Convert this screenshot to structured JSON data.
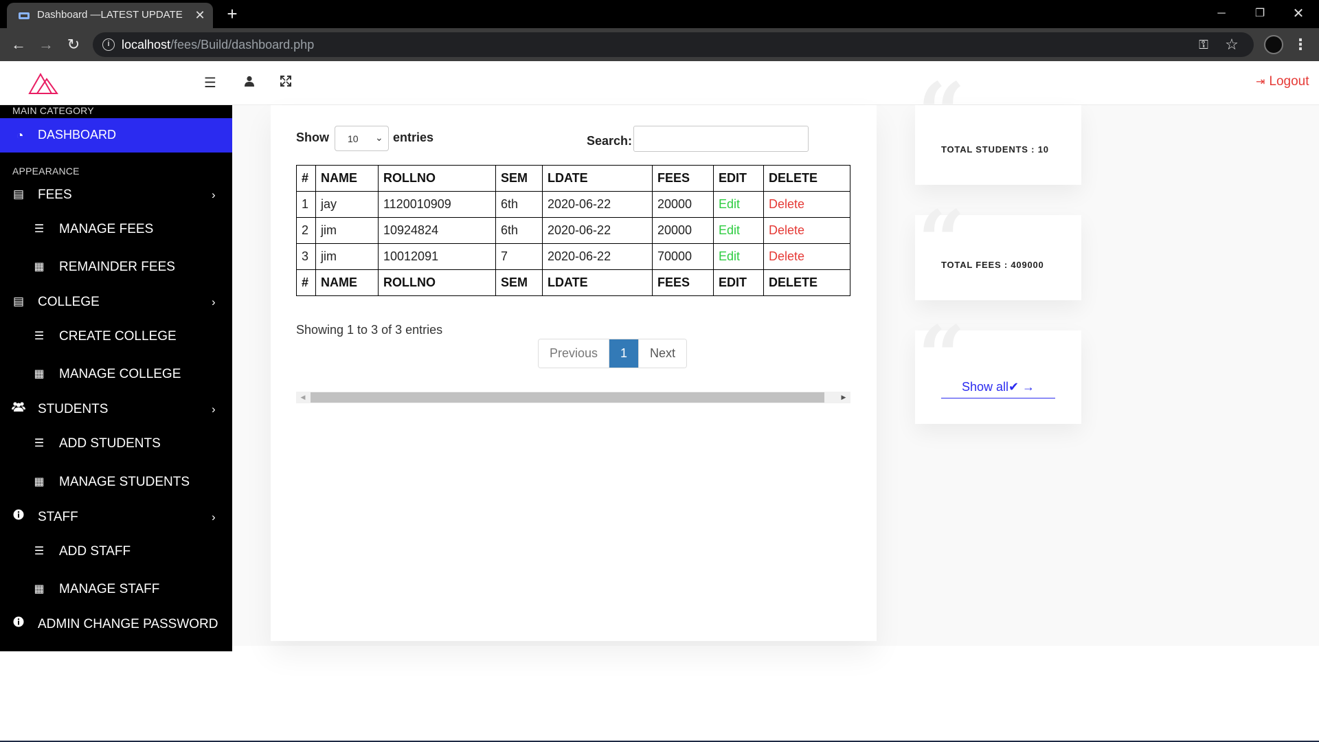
{
  "browser": {
    "tab_title": "Dashboard —LATEST UPDATE",
    "tab_close": "✕",
    "new_tab": "+",
    "url_host": "localhost",
    "url_path": "/fees/Build/dashboard.php",
    "window_controls": {
      "minimize": "─",
      "restore": "❐",
      "close": "✕"
    }
  },
  "header": {
    "logout_label": "Logout",
    "brand_color": "#e91e63"
  },
  "sidebar": {
    "main_category": "MAIN CATEGORY",
    "dashboard_label": "DASHBOARD",
    "appearance_category": "APPEARANCE",
    "sections": [
      {
        "label": "FEES",
        "icon": "file-icon",
        "children": [
          "MANAGE FEES",
          "REMAINDER FEES"
        ]
      },
      {
        "label": "COLLEGE",
        "icon": "file-icon",
        "children": [
          "CREATE COLLEGE",
          "MANAGE COLLEGE"
        ]
      },
      {
        "label": "STUDENTS",
        "icon": "users-icon",
        "children": [
          "ADD STUDENTS",
          "MANAGE STUDENTS"
        ]
      },
      {
        "label": "STAFF",
        "icon": "info-icon",
        "children": [
          "ADD STAFF",
          "MANAGE STAFF"
        ]
      }
    ],
    "admin_change_password": "ADMIN CHANGE PASSWORD",
    "active_color": "#2b2bf0"
  },
  "table_controls": {
    "show_label": "Show",
    "entries_value": "10",
    "entries_label": "entries",
    "search_label": "Search:",
    "search_value": ""
  },
  "table": {
    "columns": [
      "#",
      "NAME",
      "ROLLNO",
      "SEM",
      "LDATE",
      "FEES",
      "EDIT",
      "DELETE"
    ],
    "rows": [
      {
        "num": "1",
        "name": "jay",
        "rollno": "1120010909",
        "sem": "6th",
        "ldate": "2020-06-22",
        "fees": "20000",
        "edit": "Edit",
        "delete": "Delete"
      },
      {
        "num": "2",
        "name": "jim",
        "rollno": "10924824",
        "sem": "6th",
        "ldate": "2020-06-22",
        "fees": "20000",
        "edit": "Edit",
        "delete": "Delete"
      },
      {
        "num": "3",
        "name": "jim",
        "rollno": "10012091",
        "sem": "7",
        "ldate": "2020-06-22",
        "fees": "70000",
        "edit": "Edit",
        "delete": "Delete"
      }
    ],
    "edit_color": "#2ecc40",
    "delete_color": "#e53935"
  },
  "pagination": {
    "info": "Showing 1 to 3 of 3 entries",
    "previous": "Previous",
    "current_page": "1",
    "next": "Next"
  },
  "cards": {
    "total_students": "TOTAL STUDENTS : 10",
    "total_fees": "TOTAL FEES : 409000",
    "show_all": "Show all✔ →"
  }
}
